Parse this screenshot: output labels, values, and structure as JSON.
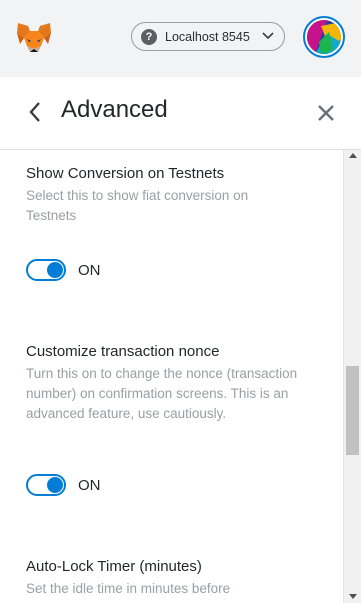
{
  "header": {
    "network_label": "Localhost 8545",
    "network_help_glyph": "?",
    "title": "Advanced"
  },
  "icons": {
    "logo": "metamask-fox-icon",
    "network_help": "question-circle-icon",
    "network_dropdown": "chevron-down-icon",
    "account": "account-avatar-icon",
    "back": "chevron-left-icon",
    "close": "close-icon"
  },
  "settings": [
    {
      "title": "Show Conversion on Testnets",
      "description": "Select this to show fiat conversion on Testnets",
      "toggle_label": "ON",
      "enabled": true
    },
    {
      "title": "Customize transaction nonce",
      "description": "Turn this on to change the nonce (transaction number) on confirmation screens. This is an advanced feature, use cautiously.",
      "toggle_label": "ON",
      "enabled": true
    },
    {
      "title": "Auto-Lock Timer (minutes)",
      "description": "Set the idle time in minutes before"
    }
  ],
  "colors": {
    "accent": "#037dd6",
    "topbar_bg": "#f2f3f4",
    "text_primary": "#24272a",
    "text_secondary": "#9b9ea3"
  }
}
